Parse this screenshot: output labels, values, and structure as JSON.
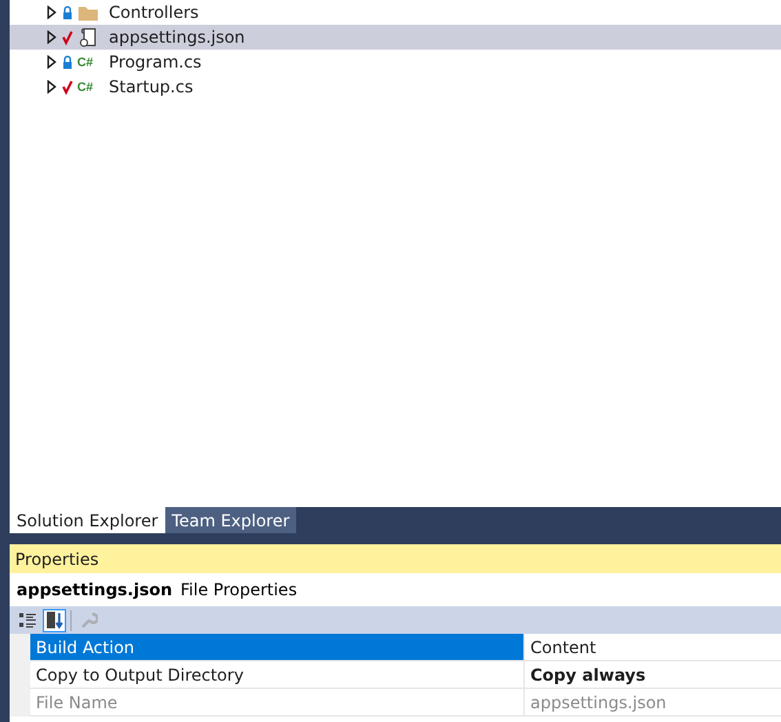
{
  "solution_explorer": {
    "items": [
      {
        "label": "Controllers",
        "checked_out": false,
        "kind": "folder",
        "selected": false
      },
      {
        "label": "appsettings.json",
        "checked_out": true,
        "kind": "json",
        "selected": true
      },
      {
        "label": "Program.cs",
        "checked_out": false,
        "kind": "code",
        "icon_text": "C#",
        "selected": false
      },
      {
        "label": "Startup.cs",
        "checked_out": true,
        "kind": "code",
        "icon_text": "C#",
        "selected": false
      }
    ]
  },
  "tabs": [
    {
      "label": "Solution Explorer",
      "selected": true
    },
    {
      "label": "Team Explorer",
      "selected": false
    }
  ],
  "properties": {
    "title": "Properties",
    "object_name": "appsettings.json",
    "object_type": "File Properties",
    "toolbar": [
      {
        "kind": "categorized",
        "selected": false,
        "disabled": false
      },
      {
        "kind": "alphabetical",
        "selected": true,
        "disabled": false
      },
      {
        "kind": "property-pages",
        "selected": false,
        "disabled": true
      }
    ],
    "rows": [
      {
        "name": "Build Action",
        "value": "Content",
        "selected": true,
        "bold": false,
        "disabled": false
      },
      {
        "name": "Copy to Output Directory",
        "value": "Copy always",
        "selected": false,
        "bold": true,
        "disabled": false
      },
      {
        "name": "File Name",
        "value": "appsettings.json",
        "selected": false,
        "bold": false,
        "disabled": true
      }
    ]
  }
}
